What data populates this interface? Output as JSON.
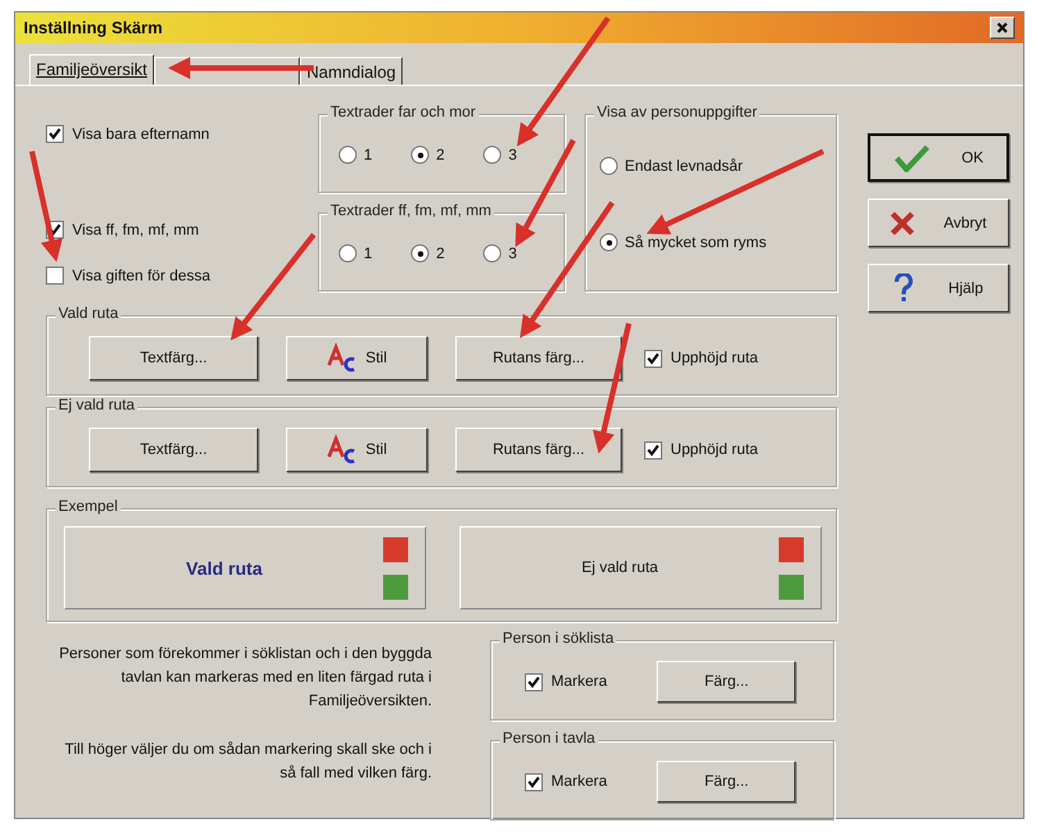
{
  "window": {
    "title": "Inställning Skärm"
  },
  "tabs": [
    {
      "label": "Familjeöversikt",
      "selected": true
    },
    {
      "selected": false
    },
    {
      "label": "Namndialog",
      "selected": false
    }
  ],
  "display_checks": [
    {
      "label": "Visa bara efternamn",
      "checked": true
    },
    {
      "label": "Visa ff, fm, mf, mm",
      "checked": true
    },
    {
      "label": "Visa giften för dessa",
      "checked": false
    }
  ],
  "text_rows_parents": {
    "title": "Textrader far och mor",
    "options": [
      {
        "label": "1",
        "selected": false
      },
      {
        "label": "2",
        "selected": true
      },
      {
        "label": "3",
        "selected": false
      }
    ]
  },
  "text_rows_grandparents": {
    "title": "Textrader ff, fm, mf, mm",
    "options": [
      {
        "label": "1",
        "selected": false
      },
      {
        "label": "2",
        "selected": true
      },
      {
        "label": "3",
        "selected": false
      }
    ]
  },
  "person_details": {
    "title": "Visa av personuppgifter",
    "options": [
      {
        "label": "Endast levnadsår",
        "selected": false
      },
      {
        "label": "Så mycket som ryms",
        "selected": true
      }
    ]
  },
  "dialog_buttons": [
    {
      "kind": "ok",
      "label": "OK"
    },
    {
      "kind": "cancel",
      "label": "Avbryt"
    },
    {
      "kind": "help",
      "label": "Hjälp"
    }
  ],
  "box_groups": [
    {
      "title": "Vald ruta",
      "text_color_button": "Textfärg...",
      "style_button": "Stil",
      "box_color_button": "Rutans färg...",
      "raised": {
        "label": "Upphöjd ruta",
        "checked": true
      }
    },
    {
      "title": "Ej vald ruta",
      "text_color_button": "Textfärg...",
      "style_button": "Stil",
      "box_color_button": "Rutans färg...",
      "raised": {
        "label": "Upphöjd ruta",
        "checked": true
      }
    }
  ],
  "example": {
    "title": "Exempel",
    "panels": [
      {
        "label": "Vald ruta",
        "selected": true,
        "marks": [
          {
            "color": "#d8392d"
          },
          {
            "color": "#4e9a3e"
          }
        ]
      },
      {
        "label": "Ej vald ruta",
        "selected": false,
        "marks": [
          {
            "color": "#d8392d"
          },
          {
            "color": "#4e9a3e"
          }
        ]
      }
    ]
  },
  "notes": [
    "Personer som förekommer i söklistan och i den byggda tavlan kan markeras med en liten färgad ruta i Familjeöversikten.",
    "Till höger väljer du om sådan markering skall ske och i så fall med vilken färg."
  ],
  "marking_groups": [
    {
      "title": "Person i söklista",
      "check": {
        "label": "Markera",
        "checked": true
      },
      "button": "Färg..."
    },
    {
      "title": "Person i tavla",
      "check": {
        "label": "Markera",
        "checked": true
      },
      "button": "Färg..."
    }
  ]
}
